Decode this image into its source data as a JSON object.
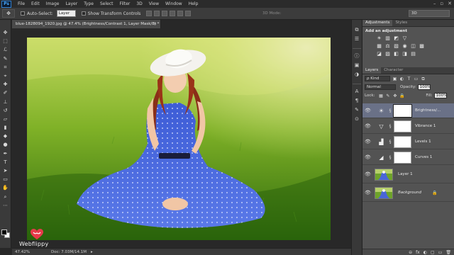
{
  "menubar": {
    "logo": "Ps",
    "items": [
      "File",
      "Edit",
      "Image",
      "Layer",
      "Type",
      "Select",
      "Filter",
      "3D",
      "View",
      "Window",
      "Help"
    ],
    "window_controls": [
      "–",
      "▫",
      "✕"
    ]
  },
  "options": {
    "tool_glyph": "✥",
    "auto_select_label": "Auto-Select:",
    "auto_select_value": "Layer",
    "transform_label": "Show Transform Controls",
    "mode_3d": "3D Mode:",
    "workspace": "3D"
  },
  "document": {
    "tab_title": "blue-1828094_1920.jpg @ 47.4% (Brightness/Contrast 1, Layer Mask/8) *",
    "tab_close": "×",
    "watermark": "Webflippy"
  },
  "status": {
    "zoom": "47.42%",
    "doc_size": "Doc: 7.03M/14.1M",
    "arrow": "▸"
  },
  "panels": {
    "adjustments_tab": "Adjustments",
    "styles_tab": "Styles",
    "add_adjustment": "Add an adjustment",
    "adj_row1": [
      "☀",
      "▥",
      "◩",
      "▽"
    ],
    "adj_row2": [
      "▦",
      "⚖",
      "▧",
      "◉",
      "◫",
      "▩"
    ],
    "adj_row3": [
      "◪",
      "▨",
      "◧",
      "◨",
      "▤"
    ]
  },
  "layers": {
    "layers_tab": "Layers",
    "character_tab": "Character",
    "filter_kind": "ρ Kind",
    "blend_mode": "Normal",
    "opacity_label": "Opacity:",
    "opacity_value": "100%",
    "lock_label": "Lock:",
    "fill_label": "Fill:",
    "fill_value": "100%",
    "items": [
      {
        "name": "Brightness/...",
        "glyph": "☀",
        "selected": true
      },
      {
        "name": "Vibrance 1",
        "glyph": "▽",
        "selected": false
      },
      {
        "name": "Levels 1",
        "glyph": "▟",
        "selected": false
      },
      {
        "name": "Curves 1",
        "glyph": "◢",
        "selected": false
      },
      {
        "name": "Layer 1",
        "glyph": "",
        "selected": false
      },
      {
        "name": "Background",
        "glyph": "",
        "selected": false
      }
    ],
    "footer_icons": [
      "⊖",
      "fx",
      "◐",
      "▢",
      "▭",
      "🗑"
    ]
  },
  "colors": {
    "app_bg": "#282828",
    "panel_bg": "#535353",
    "selected_layer": "#6a7187",
    "accent_blue": "#2f7fd1"
  }
}
